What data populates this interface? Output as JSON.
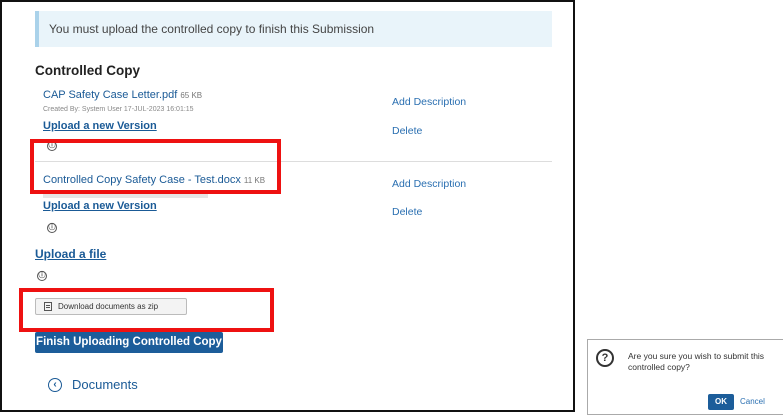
{
  "main": {
    "banner_text": "You must upload the controlled copy to finish this Submission",
    "section_title": "Controlled Copy",
    "files": [
      {
        "name": "CAP Safety Case Letter.pdf",
        "size": "65 KB",
        "created_by": "Created By: System User 17-JUL-2023 16:01:15",
        "upload_version_label": "Upload a new Version",
        "add_description_label": "Add Description",
        "delete_label": "Delete",
        "info_icon": "ⓘ"
      },
      {
        "name": "Controlled Copy Safety Case - Test.docx",
        "size": "11 KB",
        "upload_version_label": "Upload a new Version",
        "add_description_label": "Add Description",
        "delete_label": "Delete",
        "info_icon": "ⓘ"
      }
    ],
    "upload_file_label": "Upload a file",
    "upload_info_icon": "ⓘ",
    "download_zip_label": "Download documents as zip",
    "finish_button_label": "Finish Uploading Controlled Copy",
    "documents_label": "Documents",
    "documents_icon": "‹"
  },
  "dialog": {
    "icon": "?",
    "message": "Are you sure you wish to submit this controlled copy?",
    "ok_label": "OK",
    "cancel_label": "Cancel"
  },
  "colors": {
    "link": "#1a5a96",
    "primary_button": "#1c5d9a",
    "highlight": "#ee1111",
    "banner_bg": "#e9f4fa"
  },
  "icons": {
    "info": "info-circle-icon",
    "documents_toggle": "chevron-left-circle-icon",
    "zip": "document-icon",
    "dialog": "question-circle-icon"
  }
}
